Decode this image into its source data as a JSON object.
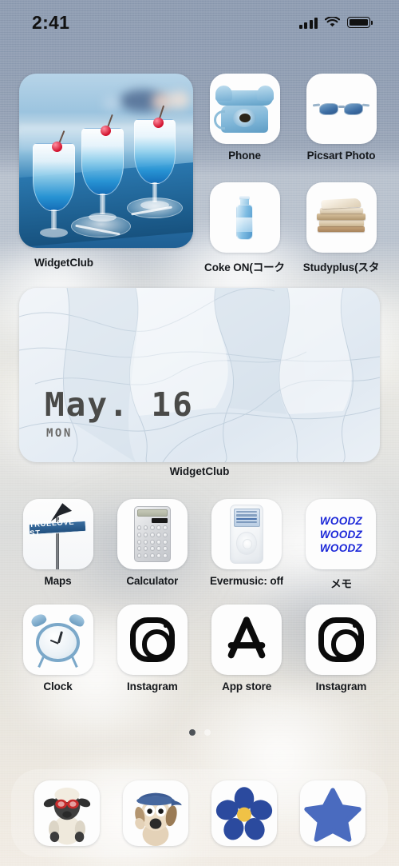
{
  "status_bar": {
    "time": "2:41",
    "signal_icon": "cellular-signal-icon",
    "wifi_icon": "wifi-icon",
    "battery_icon": "battery-icon"
  },
  "widgets": {
    "photo": {
      "label": "WidgetClub",
      "description": "blue cocktail drinks with cherries photo"
    },
    "calendar": {
      "label": "WidgetClub",
      "date": "May. 16",
      "weekday": "MON",
      "description": "marble ice texture calendar"
    }
  },
  "apps": {
    "row1": [
      {
        "name": "Phone",
        "label": "Phone",
        "icon": "rotary-phone-icon"
      },
      {
        "name": "Picsart Photo",
        "label": "Picsart Photo",
        "icon": "sunglasses-icon"
      }
    ],
    "row2": [
      {
        "name": "Coke ON",
        "label": "Coke ON(コーク",
        "icon": "soda-bottle-icon"
      },
      {
        "name": "Studyplus",
        "label": "Studyplus(スタ",
        "icon": "books-stack-icon"
      }
    ],
    "row3": [
      {
        "name": "Maps",
        "label": "Maps",
        "icon": "street-sign-icon",
        "sign_text": "TRUELOVE ST"
      },
      {
        "name": "Calculator",
        "label": "Calculator",
        "icon": "calculator-icon"
      },
      {
        "name": "Evermusic",
        "label": "Evermusic: off",
        "icon": "ipod-icon"
      },
      {
        "name": "Memo",
        "label": "メモ",
        "icon": "woodz-logo-icon",
        "logo_text": "WOODZ"
      }
    ],
    "row4": [
      {
        "name": "Clock",
        "label": "Clock",
        "icon": "alarm-clock-icon"
      },
      {
        "name": "Instagram",
        "label": "Instagram",
        "icon": "instagram-icon"
      },
      {
        "name": "App store",
        "label": "App store",
        "icon": "app-store-icon"
      },
      {
        "name": "Instagram 2",
        "label": "Instagram",
        "icon": "instagram-icon"
      }
    ]
  },
  "dock": [
    {
      "name": "Shaun the Sheep",
      "icon": "sheep-character-icon"
    },
    {
      "name": "Gromit",
      "icon": "dog-character-icon"
    },
    {
      "name": "Flower",
      "icon": "flower-icon"
    },
    {
      "name": "Star",
      "icon": "star-icon"
    }
  ],
  "page_indicator": {
    "total": 2,
    "active": 1
  },
  "colors": {
    "sky": "#8e9cb1",
    "clouds": "#e9e8e2",
    "icon_bg": "#fdfdfd",
    "label_text": "#15181c",
    "accent_blue": "#2f6fb0",
    "woodz_blue": "#1b27d8",
    "flower_blue": "#2b4a9e",
    "star_blue": "#4a6bbf"
  }
}
